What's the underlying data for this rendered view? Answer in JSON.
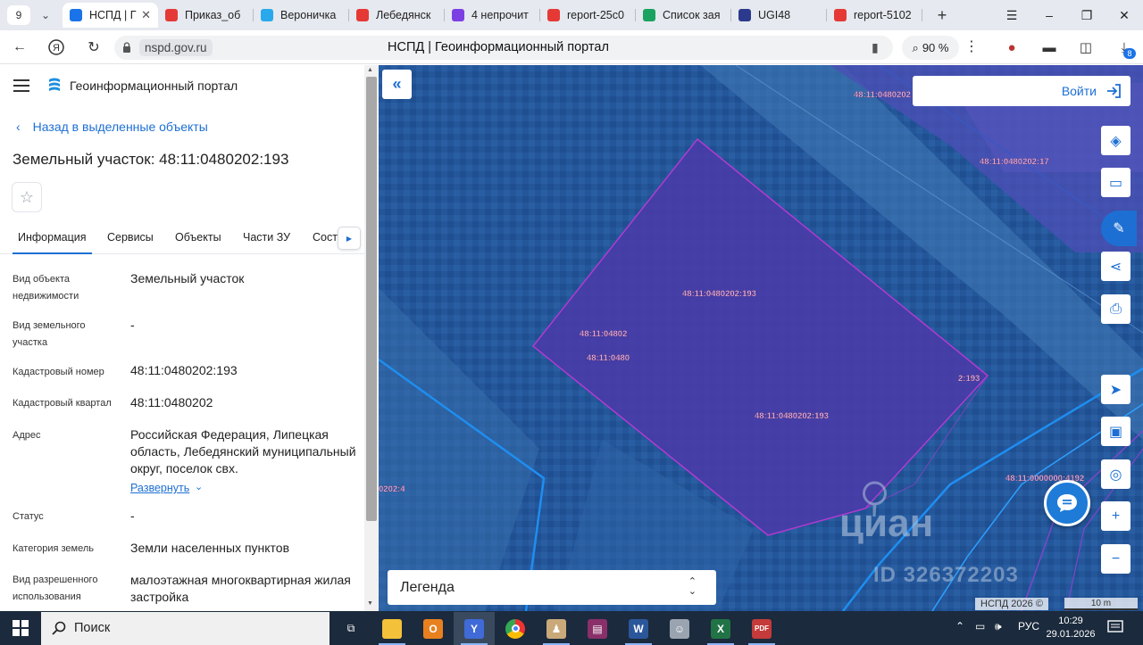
{
  "browser": {
    "tab_counter": "9",
    "tabs": [
      {
        "label": "НСПД | Г",
        "active": true,
        "color": "#1a73e8"
      },
      {
        "label": "Приказ_об",
        "active": false,
        "color": "#e53935"
      },
      {
        "label": "Вероничка",
        "active": false,
        "color": "#29a9eb"
      },
      {
        "label": "Лебедянск",
        "active": false,
        "color": "#e53935"
      },
      {
        "label": "4 непрочит",
        "active": false,
        "color": "#7b3fe4"
      },
      {
        "label": "report-25c0",
        "active": false,
        "color": "#e53935"
      },
      {
        "label": "Список зая",
        "active": false,
        "color": "#1aa260"
      },
      {
        "label": "UGI48",
        "active": false,
        "color": "#2b3a8c"
      },
      {
        "label": "report-5102",
        "active": false,
        "color": "#e53935"
      }
    ],
    "url_host": "nspd.gov.ru",
    "page_title": "НСПД | Геоинформационный портал",
    "zoom": "90 %",
    "downloads_badge": "8"
  },
  "panel": {
    "portal_name": "Геоинформационный портал",
    "back_link": "Назад в выделенные объекты",
    "object_title": "Земельный участок: 48:11:0480202:193",
    "tabs": [
      "Информация",
      "Сервисы",
      "Объекты",
      "Части ЗУ",
      "Соста"
    ],
    "expand_label": "Развернуть",
    "rows": [
      {
        "label": "Вид объекта недвижимости",
        "value": "Земельный участок"
      },
      {
        "label": "Вид земельного участка",
        "value": "-"
      },
      {
        "label": "Кадастровый номер",
        "value": "48:11:0480202:193"
      },
      {
        "label": "Кадастровый квартал",
        "value": "48:11:0480202"
      },
      {
        "label": "Адрес",
        "value": "Российская Федерация, Липецкая область, Лебедянский муниципальный округ, поселок свх."
      },
      {
        "label": "Статус",
        "value": "-"
      },
      {
        "label": "Категория земель",
        "value": "Земли населенных пунктов"
      },
      {
        "label": "Вид разрешенного использования",
        "value": "малоэтажная многоквартирная жилая застройка"
      }
    ]
  },
  "map": {
    "login_label": "Войти",
    "legend_label": "Легенда",
    "labels": {
      "top": "48:11:0480202",
      "right": "48:11:0480202:17",
      "center": "48:11:0480202:193",
      "left1": "48:11:04802",
      "left2": "48:11:0480",
      "right_edge": "2:193",
      "lower": "48:11:0480202:193",
      "far_left": "0202:4",
      "far_right": "48:11:0000000:4192"
    },
    "watermark": "циан",
    "watermark_id": "ID 326372203",
    "copyright": "НСПД 2026 ©",
    "scale": "10 m",
    "colors": {
      "parcel_fill": "#4a3aa8",
      "parcel_stroke": "#b23ad0",
      "accent": "#1d6fd3"
    }
  },
  "taskbar": {
    "search_label": "Поиск",
    "lang": "РУС",
    "time": "10:29",
    "date": "29.01.2026"
  }
}
